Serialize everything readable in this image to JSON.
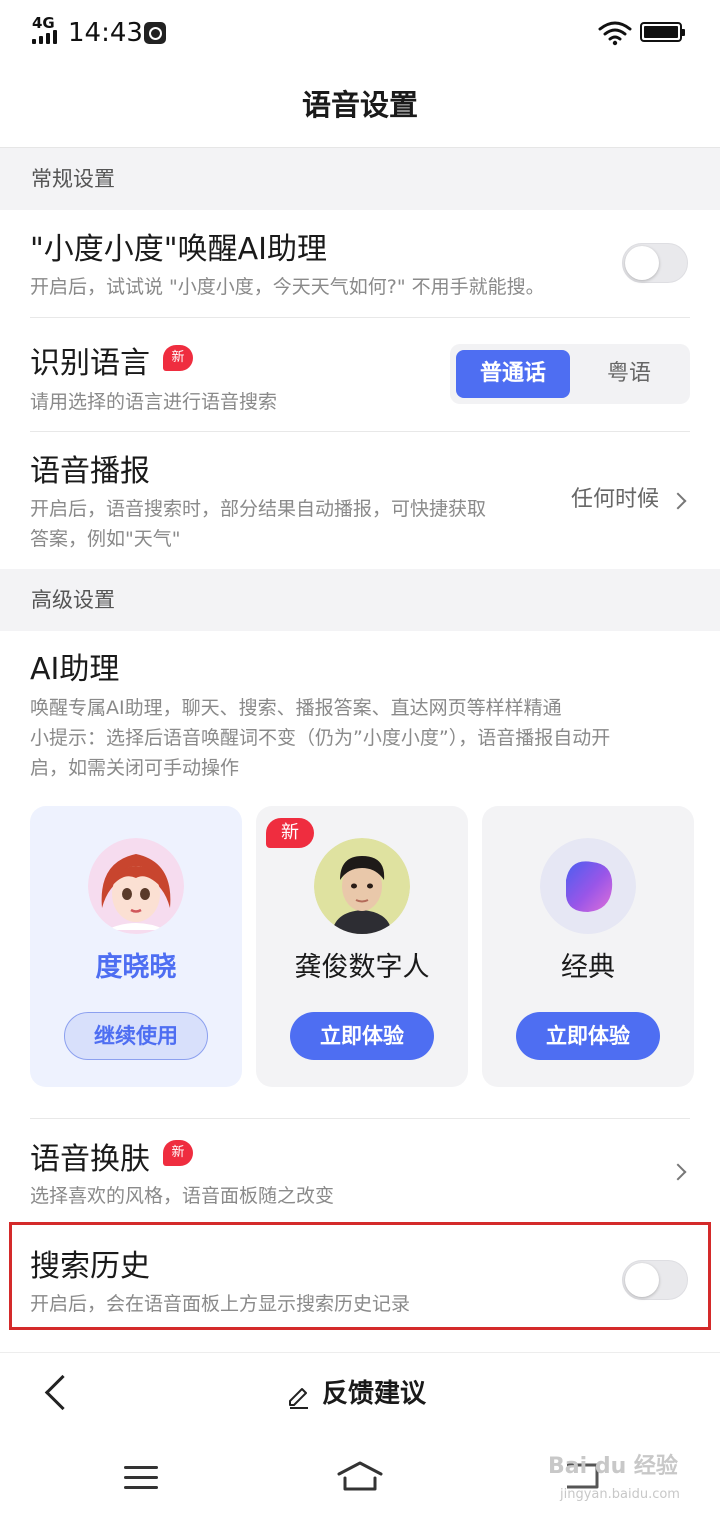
{
  "status_bar": {
    "network": "4G",
    "time": "14:43"
  },
  "page": {
    "title": "语音设置"
  },
  "sections": {
    "general": "常规设置",
    "advanced": "高级设置"
  },
  "wake": {
    "title": "\"小度小度\"唤醒AI助理",
    "desc": "开启后，试试说 \"小度小度，今天天气如何?\" 不用手就能搜。",
    "enabled": false
  },
  "language": {
    "title": "识别语言",
    "badge": "新",
    "desc": "请用选择的语言进行语音搜索",
    "options": [
      "普通话",
      "粤语"
    ],
    "selected": "普通话"
  },
  "broadcast": {
    "title": "语音播报",
    "desc_line1": "开启后，语音搜索时，部分结果自动播报，可快捷获取",
    "desc_line2": "答案，例如\"天气\"",
    "value": "任何时候"
  },
  "assistant": {
    "title": "AI助理",
    "desc": "唤醒专属AI助理，聊天、搜索、播报答案、直达网页等样样精通",
    "tip_line1": "小提示：选择后语音唤醒词不变（仍为”小度小度”），语音播报自动开",
    "tip_line2": "启，如需关闭可手动操作",
    "cards": [
      {
        "name": "度晓晓",
        "button": "继续使用",
        "active": true
      },
      {
        "name": "龚俊数字人",
        "button": "立即体验",
        "badge": "新"
      },
      {
        "name": "经典",
        "button": "立即体验"
      }
    ]
  },
  "skin": {
    "title": "语音换肤",
    "badge": "新",
    "desc": "选择喜欢的风格，语音面板随之改变"
  },
  "history": {
    "title": "搜索历史",
    "desc": "开启后，会在语音面板上方显示搜索历史记录",
    "enabled": false
  },
  "footer": {
    "feedback": "反馈建议"
  },
  "watermark": {
    "text": "Bai du 经验",
    "url": "jingyan.baidu.com"
  },
  "colors": {
    "accent": "#4e6ef2",
    "badge": "#ef2d3f",
    "highlight": "#d42a2a"
  }
}
